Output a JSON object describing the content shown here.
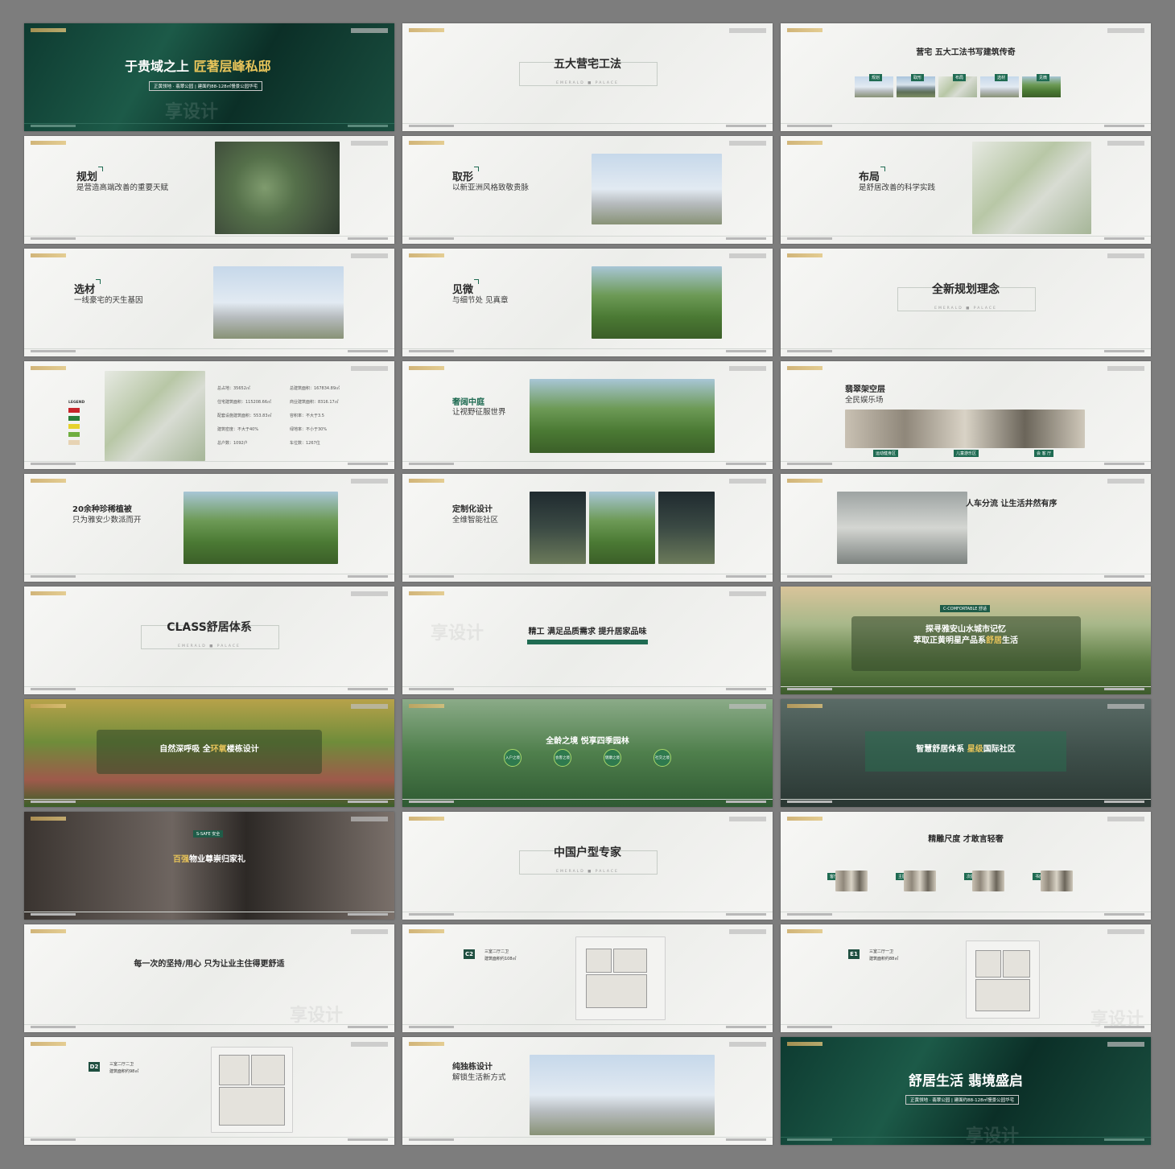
{
  "s1": {
    "title_a": "于贵域之上",
    "title_b": "匠著层峰私邸",
    "pill": "正黄领地 · 翡翠公园 | 建面约88-128㎡慢景公园华宅"
  },
  "s2": {
    "title": "五大营宅工法",
    "sub": "EMERALD ■ PALACE"
  },
  "s3": {
    "title": "营宅 五大工法书写建筑传奇",
    "tags": [
      "规划",
      "取形",
      "布局",
      "选材",
      "见微"
    ]
  },
  "s4": {
    "title": "规划",
    "sub": "是营造高端改善的重要天赋"
  },
  "s5": {
    "title": "取形",
    "sub": "以新亚洲风格致敬贵脉"
  },
  "s6": {
    "title": "布局",
    "sub": "是舒居改善的科学实践"
  },
  "s7": {
    "title": "选材",
    "sub": "一线豪宅的天生基因"
  },
  "s8": {
    "title": "见微",
    "sub": "与细节处 见真章"
  },
  "s9": {
    "title": "全新规划理念",
    "sub": "EMERALD ■ PALACE"
  },
  "s10": {
    "legend_title": "LEGEND",
    "stats": [
      "总占地：35652㎡",
      "总建筑面积：167834.89㎡",
      "住宅建筑面积：115208.66㎡",
      "商业建筑面积：8316.17㎡",
      "配套设施建筑面积：553.83㎡",
      "容积率：不大于3.5",
      "建筑密度：不大于40%",
      "绿地率：不小于30%",
      "总户数：1092户",
      "车位数：1267位"
    ]
  },
  "s11": {
    "title": "奢阔中庭",
    "sub": "让视野征服世界"
  },
  "s12": {
    "title": "翡翠架空层",
    "sub": "全民娱乐场",
    "tags": [
      "运动健身区",
      "儿童游乐区",
      "会 客 厅"
    ]
  },
  "s13": {
    "title": "20余种珍稀植被",
    "sub": "只为雅安少数派而开"
  },
  "s14": {
    "title": "定制化设计",
    "sub": "全维智能社区"
  },
  "s15": {
    "title": "人车分流 让生活井然有序"
  },
  "s16": {
    "title": "CLASS舒居体系",
    "sub": "EMERALD ■ PALACE"
  },
  "s17": {
    "title": "精工 满足品质需求 提升居家品味"
  },
  "s18": {
    "ribbon": "C-COMFORTABLE 舒适",
    "title_a": "探寻雅安山水城市记忆",
    "title_b": "萃取正黄明星产品系",
    "title_gold": "舒居",
    "title_c": "生活"
  },
  "s19": {
    "title_a": "自然深呼吸 全",
    "title_gold": "环氧",
    "title_b": "楼栋设计"
  },
  "s20": {
    "title": "全龄之境 悦享四季园林",
    "circles": [
      "入户之境",
      "会客之境",
      "健康之境",
      "社交之境"
    ]
  },
  "s21": {
    "title_a": "智慧舒居体系 ",
    "title_gold": "星级",
    "title_b": "国际社区"
  },
  "s22": {
    "ribbon": "S-SAFE 安全",
    "title_a": "百强",
    "title_b": "物业尊崇归家礼"
  },
  "s23": {
    "title": "中国户型专家",
    "sub": "EMERALD ■ PALACE"
  },
  "s24": {
    "title": "精雕尺度 才敢言轻奢",
    "rooms": [
      "客厅",
      "主卧",
      "次卧",
      "书房"
    ]
  },
  "s25": {
    "title": "每一次的坚持/用心 只为让业主住得更舒适"
  },
  "s26": {
    "badge": "C2",
    "title": "三室二厅二卫",
    "area": "建筑面积约108㎡"
  },
  "s27": {
    "badge": "E1",
    "title": "三室二厅一卫",
    "area": "建筑面积约88㎡"
  },
  "s28": {
    "badge": "D2",
    "title": "三室二厅二卫",
    "area": "建筑面积约98㎡"
  },
  "s29": {
    "title": "纯独栋设计",
    "sub": "解锁生活新方式"
  },
  "s30": {
    "title": "舒居生活 翡境盛启",
    "pill": "正黄领地 · 翡翠公园 | 建面约88-128㎡慢景公园华宅"
  },
  "watermark": "享设计"
}
